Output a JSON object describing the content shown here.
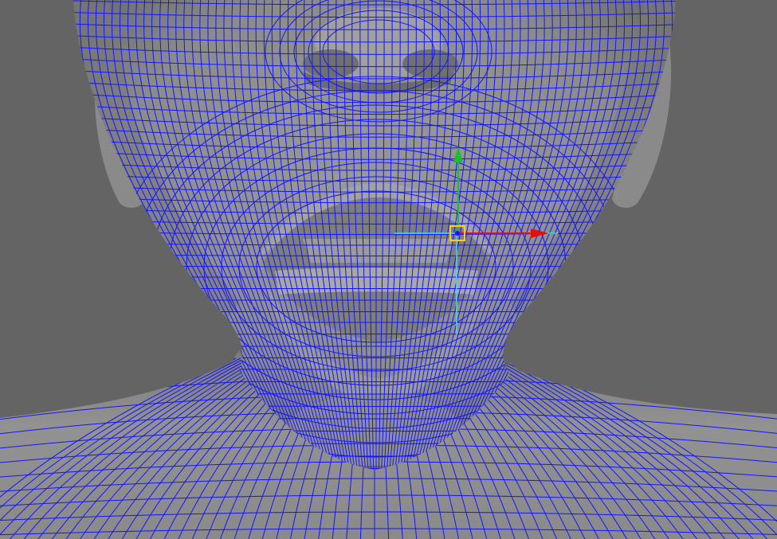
{
  "viewport": {
    "background_color": "#646464",
    "mesh_fill_color": "#8f8f8f",
    "wire_color": "#1414ff",
    "shadow_color": "#5d5d5d",
    "highlight_color": "#b4b4b4",
    "display_mode": "wireframe-on-shaded",
    "subject": "head-and-shoulders-mesh"
  },
  "manipulator": {
    "type": "move-tool",
    "x_axis_color": "#e01010",
    "y_axis_color": "#18c030",
    "z_axis_color": "#40e0e0",
    "handle_color": "#ffd000",
    "icons": [
      "x-axis-arrow-icon",
      "y-axis-arrow-icon",
      "center-handle-icon"
    ]
  }
}
